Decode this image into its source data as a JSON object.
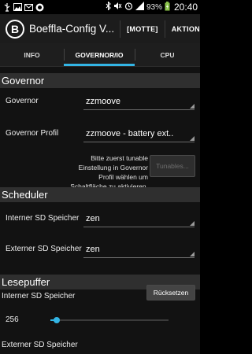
{
  "status_bar": {
    "icons_left": [
      "usb-icon",
      "image-icon",
      "mail-icon",
      "sync-icon"
    ],
    "battery": "93%",
    "clock": "20:40"
  },
  "action_bar": {
    "title": "Boeffla-Config V...",
    "motte_label": "[MOTTE]",
    "aktion_label": "AKTION"
  },
  "tabs": [
    "INFO",
    "GOVERNOR/IO",
    "CPU"
  ],
  "governor_section": {
    "header": "Governor",
    "governor_label": "Governor",
    "governor_value": "zzmoove",
    "profile_label": "Governor Profil",
    "profile_value": "zzmoove - battery ext..",
    "hint": "Bitte zuerst tunable Einstellung in Governor Profil wählen um Schaltfläche zu aktivieren.",
    "tunables_label": "Tunables..."
  },
  "scheduler_section": {
    "header": "Scheduler",
    "internal_label": "Interner SD Speicher",
    "internal_value": "zen",
    "external_label": "Externer SD Speicher",
    "external_value": "zen"
  },
  "readahead_section": {
    "header": "Lesepuffer",
    "reset_label": "Rücksetzen",
    "internal_label": "Interner SD Speicher",
    "internal_value": "256",
    "internal_fraction": 0.05,
    "external_label": "Externer SD Speicher"
  },
  "colors": {
    "accent": "#33b5e5",
    "section_bg": "#2f2f2f",
    "content_bg": "#121212"
  }
}
